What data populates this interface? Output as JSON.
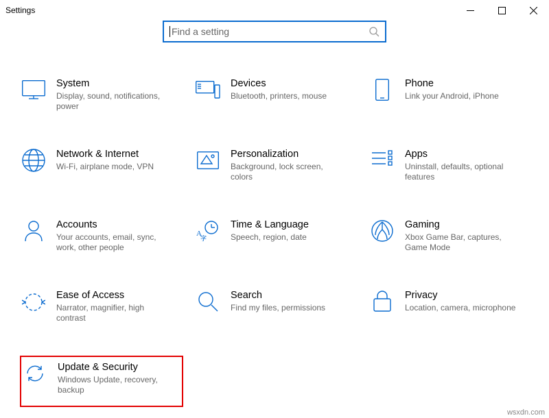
{
  "window": {
    "title": "Settings"
  },
  "search": {
    "placeholder": "Find a setting"
  },
  "tiles": [
    {
      "id": "system",
      "title": "System",
      "desc": "Display, sound, notifications, power"
    },
    {
      "id": "devices",
      "title": "Devices",
      "desc": "Bluetooth, printers, mouse"
    },
    {
      "id": "phone",
      "title": "Phone",
      "desc": "Link your Android, iPhone"
    },
    {
      "id": "network",
      "title": "Network & Internet",
      "desc": "Wi-Fi, airplane mode, VPN"
    },
    {
      "id": "personalize",
      "title": "Personalization",
      "desc": "Background, lock screen, colors"
    },
    {
      "id": "apps",
      "title": "Apps",
      "desc": "Uninstall, defaults, optional features"
    },
    {
      "id": "accounts",
      "title": "Accounts",
      "desc": "Your accounts, email, sync, work, other people"
    },
    {
      "id": "time",
      "title": "Time & Language",
      "desc": "Speech, region, date"
    },
    {
      "id": "gaming",
      "title": "Gaming",
      "desc": "Xbox Game Bar, captures, Game Mode"
    },
    {
      "id": "ease",
      "title": "Ease of Access",
      "desc": "Narrator, magnifier, high contrast"
    },
    {
      "id": "search",
      "title": "Search",
      "desc": "Find my files, permissions"
    },
    {
      "id": "privacy",
      "title": "Privacy",
      "desc": "Location, camera, microphone"
    },
    {
      "id": "update",
      "title": "Update & Security",
      "desc": "Windows Update, recovery, backup"
    }
  ],
  "highlight_tile": "update",
  "watermark": "wsxdn.com",
  "colors": {
    "accent": "#0a6bcf",
    "highlight_border": "#e30000",
    "desc_text": "#666666"
  }
}
